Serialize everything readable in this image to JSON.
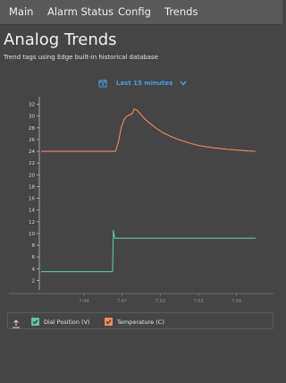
{
  "nav": {
    "items": [
      {
        "label": "Main"
      },
      {
        "label": "Alarm Status"
      },
      {
        "label": "Config"
      },
      {
        "label": "Trends"
      }
    ]
  },
  "page": {
    "title": "Analog Trends",
    "subtitle": "Trend tags using Edge built-in historical database"
  },
  "range": {
    "label": "Last 15 minutes",
    "icon": "calendar-icon",
    "dropdown_icon": "chevron-down-icon",
    "color": "#4a9fe6"
  },
  "legend": {
    "export_icon": "export-icon",
    "items": [
      {
        "label": "Dial Position (V)",
        "color": "#5fc4a6"
      },
      {
        "label": "Temperature (C)",
        "color": "#f08a5d"
      }
    ]
  },
  "chart_data": {
    "type": "line",
    "title": "",
    "xlabel": "",
    "ylabel": "",
    "ylim": [
      1,
      33
    ],
    "y_ticks": [
      "2",
      "4",
      "6",
      "8",
      "10",
      "12",
      "14",
      "16",
      "18",
      "20",
      "22",
      "24",
      "26",
      "28",
      "30",
      "32"
    ],
    "xlim": [
      0,
      15
    ],
    "x_ticks": [
      {
        "x": 3,
        "label": "7:44"
      },
      {
        "x": 5.66,
        "label": "7:47"
      },
      {
        "x": 8.33,
        "label": "7:50"
      },
      {
        "x": 11,
        "label": "7:53"
      },
      {
        "x": 13.66,
        "label": "7:56"
      }
    ],
    "grid": false,
    "series": [
      {
        "name": "Temperature (C)",
        "color": "#f08a5d",
        "x": [
          0,
          5.2,
          5.4,
          5.6,
          5.8,
          6.0,
          6.2,
          6.4,
          6.5,
          6.7,
          6.9,
          7.0,
          7.2,
          7.5,
          8.0,
          8.5,
          9.0,
          9.5,
          10.0,
          10.5,
          11.0,
          11.5,
          12.0,
          12.5,
          13.0,
          13.5,
          14.0,
          14.5,
          15.0
        ],
        "values": [
          24,
          24,
          25.5,
          28,
          29.4,
          30,
          30.2,
          30.5,
          31.2,
          31,
          30.5,
          30.2,
          29.6,
          29,
          28,
          27.2,
          26.6,
          26.1,
          25.7,
          25.3,
          25,
          24.8,
          24.6,
          24.5,
          24.35,
          24.25,
          24.15,
          24.05,
          24
        ]
      },
      {
        "name": "Dial Position (V)",
        "color": "#5fc4a6",
        "x": [
          0,
          4.8,
          5.0,
          5.05,
          5.15,
          15.0
        ],
        "values": [
          3.5,
          3.5,
          3.5,
          10.5,
          9.2,
          9.2
        ]
      }
    ]
  }
}
